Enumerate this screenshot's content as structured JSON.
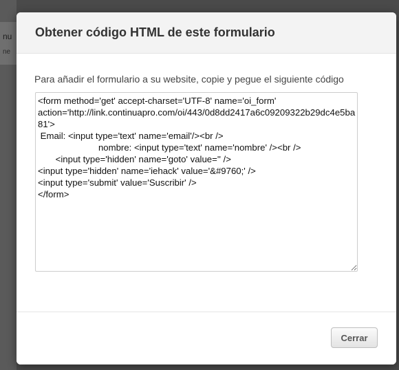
{
  "background": {
    "partial_text_1": "nu",
    "partial_text_2": "ne"
  },
  "modal": {
    "title": "Obtener código HTML de este formulario",
    "instructions": "Para añadir el formulario a su website, copie y pegue el siguiente código",
    "code": "<form method='get' accept-charset='UTF-8' name='oi_form' action='http://link.continuapro.com/oi/443/0d8dd2417a6c09209322b29dc4e5ba81'>\n Email: <input type='text' name='email'/><br />\n                        nombre: <input type='text' name='nombre' /><br />\n       <input type='hidden' name='goto' value='' />\n<input type='hidden' name='iehack' value='&#9760;' />\n<input type='submit' value='Suscribir' />\n</form>",
    "close_label": "Cerrar"
  }
}
